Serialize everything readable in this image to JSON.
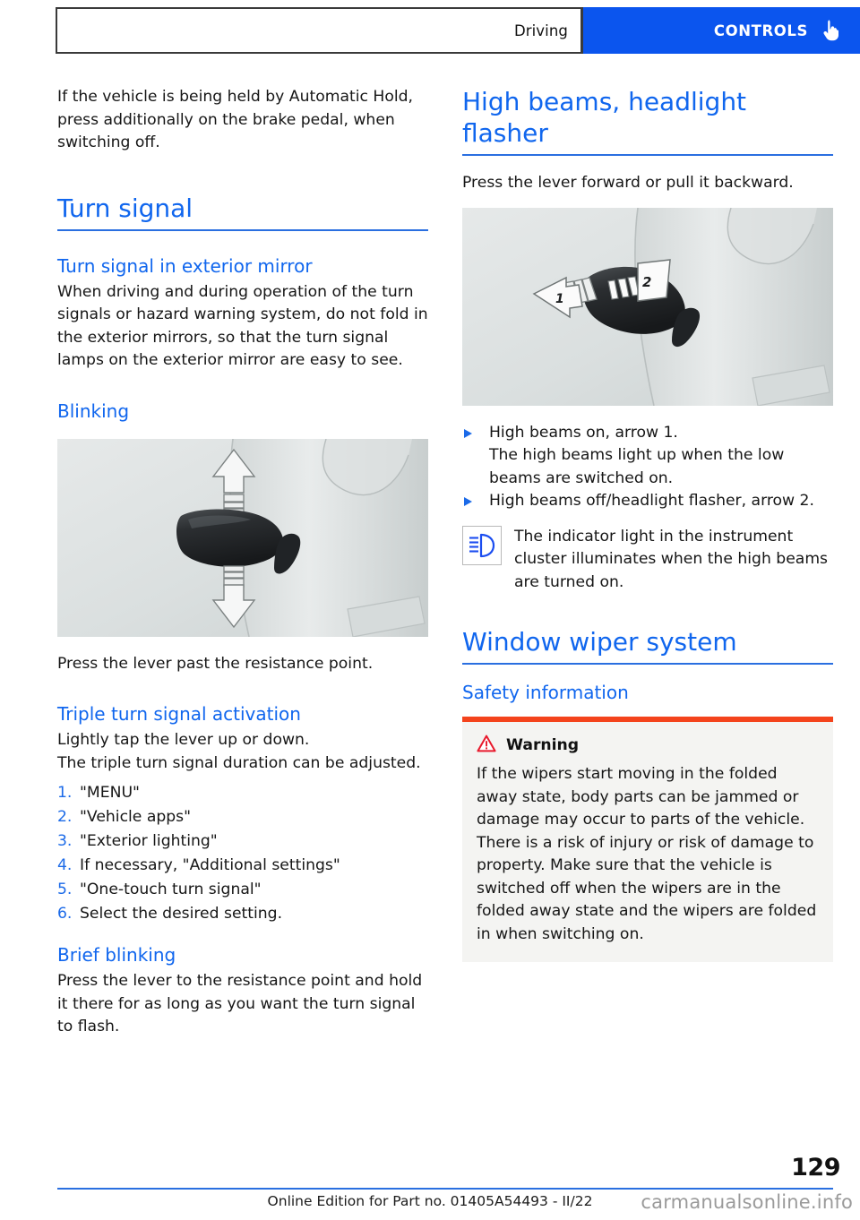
{
  "header": {
    "section_label": "Driving",
    "chapter_label": "CONTROLS",
    "hand_icon": "pointing-hand-icon"
  },
  "colors": {
    "accent_blue": "#0b55ee",
    "heading_blue": "#1066ee",
    "warning_orange": "#f4431c",
    "warning_red": "#e8192c",
    "warning_bg": "#f4f4f2"
  },
  "left_column": {
    "intro_paragraph": "If the vehicle is being held by Automatic Hold, press additionally on the brake pedal, when switching off.",
    "section_title": "Turn signal",
    "sub1": {
      "title": "Turn signal in exterior mirror",
      "body": "When driving and during operation of the turn signals or hazard warning system, do not fold in the exterior mirrors, so that the turn signal lamps on the exterior mirror are easy to see."
    },
    "sub2": {
      "title": "Blinking",
      "figure_alt": "turn-signal-stalk-up-down-arrows",
      "caption": "Press the lever past the resistance point."
    },
    "sub3": {
      "title": "Triple turn signal activation",
      "line1": "Lightly tap the lever up or down.",
      "line2": "The triple turn signal duration can be adjusted.",
      "steps": [
        {
          "num": "1.",
          "text": "\"MENU\""
        },
        {
          "num": "2.",
          "text": "\"Vehicle apps\""
        },
        {
          "num": "3.",
          "text": "\"Exterior lighting\""
        },
        {
          "num": "4.",
          "text": "If necessary, \"Additional settings\""
        },
        {
          "num": "5.",
          "text": "\"One-touch turn signal\""
        },
        {
          "num": "6.",
          "text": "Select the desired setting."
        }
      ]
    },
    "sub4": {
      "title": "Brief blinking",
      "body": "Press the lever to the resistance point and hold it there for as long as you want the turn signal to flash."
    }
  },
  "right_column": {
    "section_title": "High beams, headlight flasher",
    "intro": "Press the lever forward or pull it backward.",
    "figure_alt": "high-beam-lever-arrows-1-2",
    "bullets": [
      {
        "text": "High beams on, arrow 1.",
        "continuation": "The high beams light up when the low beams are switched on."
      },
      {
        "text": "High beams off/headlight flasher, arrow 2.",
        "continuation": ""
      }
    ],
    "indicator_note": {
      "icon": "high-beam-indicator-icon",
      "text": "The indicator light in the instrument cluster illuminates when the high beams are turned on."
    },
    "section_title_2": "Window wiper system",
    "sub_title_2": "Safety information",
    "warning": {
      "icon": "warning-triangle-icon",
      "label": "Warning",
      "body": "If the wipers start moving in the folded away state, body parts can be jammed or damage may occur to parts of the vehicle. There is a risk of injury or risk of damage to property. Make sure that the vehicle is switched off when the wipers are in the folded away state and the wipers are folded in when switching on."
    }
  },
  "footer": {
    "page_number": "129",
    "edition_line": "Online Edition for Part no. 01405A54493 - II/22",
    "watermark": "carmanualsonline.info"
  }
}
